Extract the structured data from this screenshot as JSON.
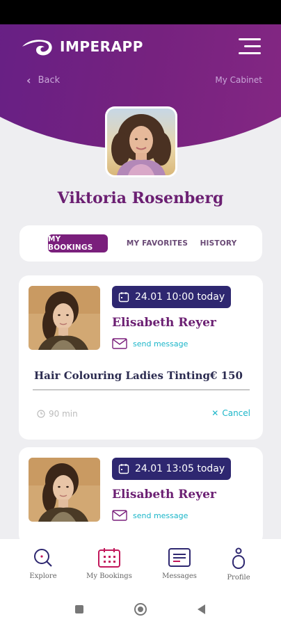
{
  "app": {
    "name": "IMPERAPP"
  },
  "header": {
    "back_label": "Back",
    "cabinet_label": "My Cabinet"
  },
  "user": {
    "name": "Viktoria Rosenberg"
  },
  "tabs": [
    {
      "label": "MY BOOKINGS",
      "active": true
    },
    {
      "label": "MY FAVORITES",
      "active": false
    },
    {
      "label": "HISTORY",
      "active": false
    }
  ],
  "bookings": [
    {
      "date": "24.01",
      "time": "10:00",
      "day": "today",
      "professional": "Elisabeth Reyer",
      "message_label": "send message",
      "service": "Hair Colouring Ladies Tinting",
      "price": "€ 150",
      "duration": "90 min",
      "cancel_label": "Cancel"
    },
    {
      "date": "24.01",
      "time": "13:05",
      "day": "today",
      "professional": "Elisabeth Reyer",
      "message_label": "send message"
    }
  ],
  "bottom_nav": [
    {
      "label": "Explore",
      "icon": "search-icon"
    },
    {
      "label": "My Bookings",
      "icon": "calendar-icon"
    },
    {
      "label": "Messages",
      "icon": "message-icon"
    },
    {
      "label": "Profile",
      "icon": "person-icon"
    }
  ],
  "colors": {
    "brand_purple": "#7a1f7c",
    "badge_navy": "#2e2770",
    "accent_cyan": "#1bb6c9",
    "name_purple": "#6b1f72"
  }
}
